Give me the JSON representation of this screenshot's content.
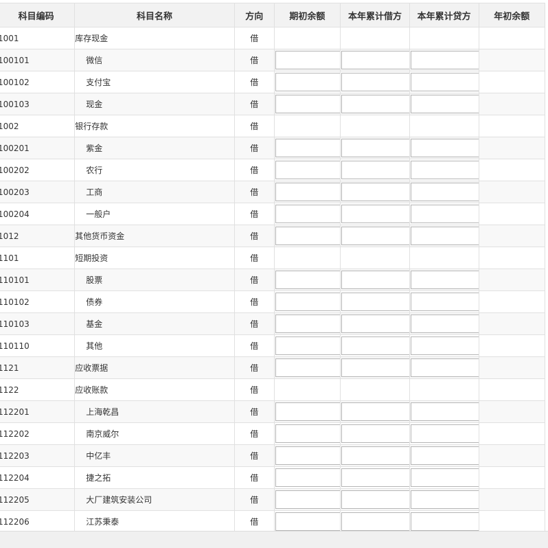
{
  "columns": [
    "科目编码",
    "科目名称",
    "方向",
    "期初余额",
    "本年累计借方",
    "本年累计贷方",
    "年初余额"
  ],
  "rows": [
    {
      "code": "1001",
      "name": "库存现金",
      "direction": "借",
      "editable": false,
      "child": false
    },
    {
      "code": "100101",
      "name": "微信",
      "direction": "借",
      "editable": true,
      "child": true
    },
    {
      "code": "100102",
      "name": "支付宝",
      "direction": "借",
      "editable": true,
      "child": true
    },
    {
      "code": "100103",
      "name": "现金",
      "direction": "借",
      "editable": true,
      "child": true
    },
    {
      "code": "1002",
      "name": "银行存款",
      "direction": "借",
      "editable": false,
      "child": false
    },
    {
      "code": "100201",
      "name": "紫金",
      "direction": "借",
      "editable": true,
      "child": true
    },
    {
      "code": "100202",
      "name": "农行",
      "direction": "借",
      "editable": true,
      "child": true
    },
    {
      "code": "100203",
      "name": "工商",
      "direction": "借",
      "editable": true,
      "child": true
    },
    {
      "code": "100204",
      "name": "一般户",
      "direction": "借",
      "editable": true,
      "child": true
    },
    {
      "code": "1012",
      "name": "其他货币资金",
      "direction": "借",
      "editable": true,
      "child": false
    },
    {
      "code": "1101",
      "name": "短期投资",
      "direction": "借",
      "editable": false,
      "child": false
    },
    {
      "code": "110101",
      "name": "股票",
      "direction": "借",
      "editable": true,
      "child": true
    },
    {
      "code": "110102",
      "name": "债券",
      "direction": "借",
      "editable": true,
      "child": true
    },
    {
      "code": "110103",
      "name": "基金",
      "direction": "借",
      "editable": true,
      "child": true
    },
    {
      "code": "110110",
      "name": "其他",
      "direction": "借",
      "editable": true,
      "child": true
    },
    {
      "code": "1121",
      "name": "应收票据",
      "direction": "借",
      "editable": true,
      "child": false
    },
    {
      "code": "1122",
      "name": "应收账款",
      "direction": "借",
      "editable": false,
      "child": false
    },
    {
      "code": "112201",
      "name": "上海乾昌",
      "direction": "借",
      "editable": true,
      "child": true
    },
    {
      "code": "112202",
      "name": "南京威尔",
      "direction": "借",
      "editable": true,
      "child": true
    },
    {
      "code": "112203",
      "name": "中亿丰",
      "direction": "借",
      "editable": true,
      "child": true
    },
    {
      "code": "112204",
      "name": "捷之拓",
      "direction": "借",
      "editable": true,
      "child": true
    },
    {
      "code": "112205",
      "name": "大厂建筑安装公司",
      "direction": "借",
      "editable": true,
      "child": true
    },
    {
      "code": "112206",
      "name": "江苏秉泰",
      "direction": "借",
      "editable": true,
      "child": true
    }
  ]
}
